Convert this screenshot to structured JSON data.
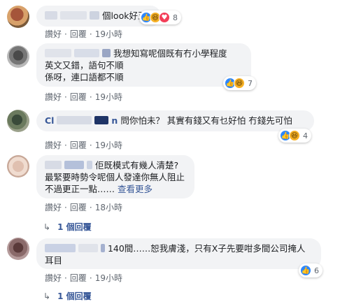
{
  "comments": [
    {
      "text_lines": [
        "個look好正"
      ],
      "reaction_count": "8",
      "actions": {
        "like": "讚好",
        "reply": "回覆",
        "time": "19小時"
      }
    },
    {
      "name_suffix": "我想知寫呢個既有冇小學程度",
      "text_lines": [
        "英文又錯，語句不順",
        "係呀，連口語都不順"
      ],
      "reaction_count": "7",
      "actions": {
        "like": "讚好",
        "reply": "回覆",
        "time": "19小時"
      }
    },
    {
      "name_prefix": "Cl",
      "name_suffix": "n",
      "text_lines": [
        "問你怕未？ 其實有錢又有乜好怕 冇錢先可怕"
      ],
      "reaction_count": "4",
      "actions": {
        "like": "讚好",
        "reply": "回覆",
        "time": "19小時"
      }
    },
    {
      "text_lines": [
        "佢既模式有幾人清楚?",
        "最緊要時勢令呢個人發達你無人阻止",
        "不過更正一點……"
      ],
      "see_more": "查看更多",
      "actions": {
        "like": "讚好",
        "reply": "回覆",
        "time": "18小時"
      },
      "replies_label": "1 個回覆"
    },
    {
      "text_lines": [
        "140間……恕我膚淺，只有X子先要咁多間公司掩人",
        "耳目"
      ],
      "reaction_count": "6",
      "actions": {
        "like": "讚好",
        "reply": "回覆",
        "time": "19小時"
      },
      "replies_label": "1 個回覆"
    }
  ],
  "colors": {
    "bubble": "#f2f3f5",
    "name_link": "#385898",
    "meta_text": "#606770",
    "like_blue": "#2d88ff",
    "haha_yellow": "#f7b125",
    "love_red": "#f33e58"
  }
}
